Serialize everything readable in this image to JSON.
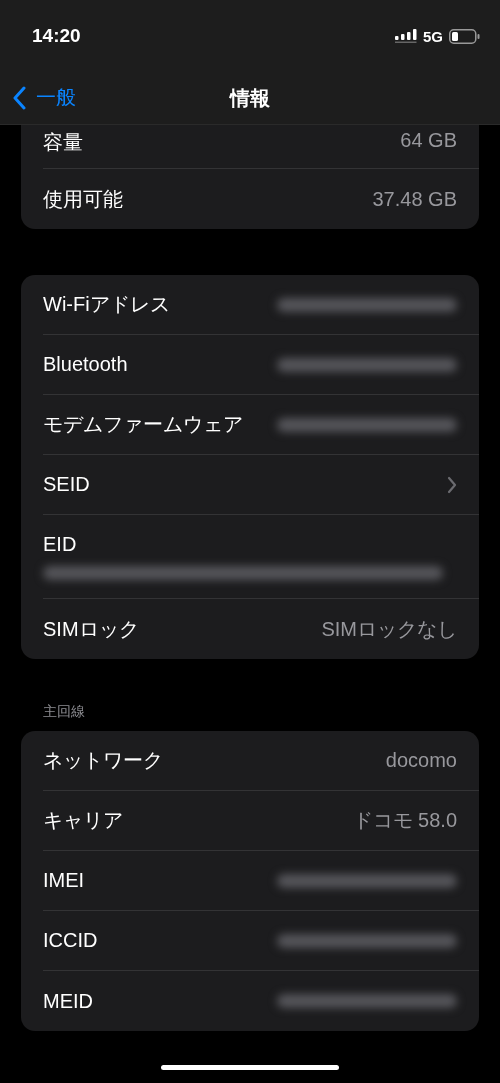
{
  "status_bar": {
    "time": "14:20",
    "network": "5G"
  },
  "nav": {
    "back": "一般",
    "title": "情報"
  },
  "groups": [
    {
      "rows": [
        {
          "kind": "value",
          "label": "容量",
          "value": "64 GB"
        },
        {
          "kind": "value",
          "label": "使用可能",
          "value": "37.48 GB"
        }
      ]
    },
    {
      "rows": [
        {
          "kind": "redacted",
          "label": "Wi-Fiアドレス"
        },
        {
          "kind": "redacted",
          "label": "Bluetooth"
        },
        {
          "kind": "redacted",
          "label": "モデムファームウェア"
        },
        {
          "kind": "link",
          "label": "SEID"
        },
        {
          "kind": "redacted_below",
          "label": "EID"
        },
        {
          "kind": "value",
          "label": "SIMロック",
          "value": "SIMロックなし"
        }
      ]
    },
    {
      "header": "主回線",
      "rows": [
        {
          "kind": "value",
          "label": "ネットワーク",
          "value": "docomo"
        },
        {
          "kind": "value",
          "label": "キャリア",
          "value": "ドコモ 58.0"
        },
        {
          "kind": "redacted",
          "label": "IMEI"
        },
        {
          "kind": "redacted",
          "label": "ICCID"
        },
        {
          "kind": "redacted",
          "label": "MEID"
        }
      ]
    }
  ]
}
